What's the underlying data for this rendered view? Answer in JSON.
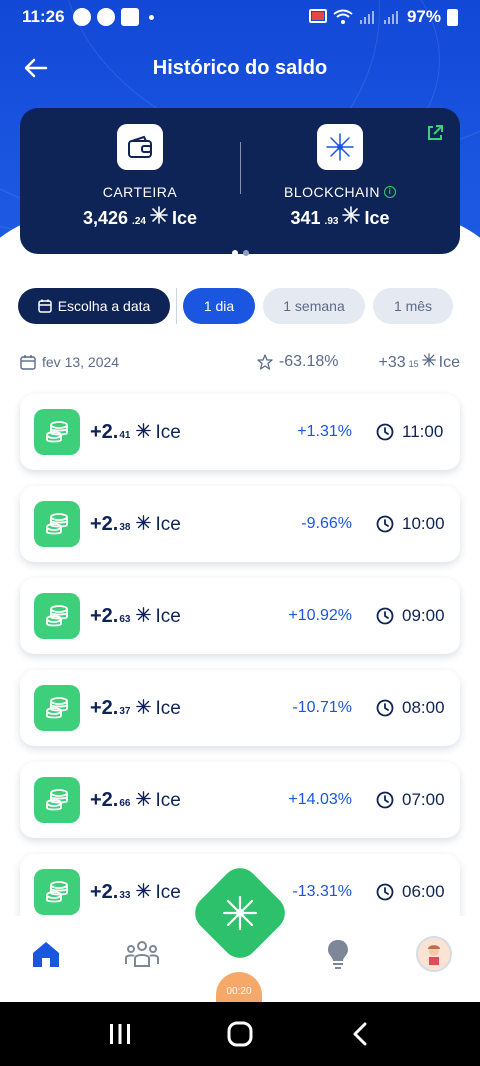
{
  "status_bar": {
    "time": "11:26",
    "battery": "97%"
  },
  "header": {
    "title": "Histórico do saldo"
  },
  "wallet": {
    "carteira": {
      "label": "CARTEIRA",
      "whole": "3,426",
      "fraction": ".24",
      "unit": "Ice"
    },
    "blockchain": {
      "label": "BLOCKCHAIN",
      "whole": "341",
      "fraction": ".93",
      "unit": "Ice"
    }
  },
  "filters": {
    "date_button": "Escolha a data",
    "chips": [
      "1 dia",
      "1 semana",
      "1 mês"
    ],
    "active_chip": "1 dia"
  },
  "summary": {
    "date": "fev 13, 2024",
    "change": "-63.18%",
    "total_whole": "+33",
    "total_fraction": "15",
    "unit": "Ice"
  },
  "history": [
    {
      "whole": "+2.",
      "fraction": "41",
      "unit": "Ice",
      "pct": "+1.31%",
      "time": "11:00"
    },
    {
      "whole": "+2.",
      "fraction": "38",
      "unit": "Ice",
      "pct": "-9.66%",
      "time": "10:00"
    },
    {
      "whole": "+2.",
      "fraction": "63",
      "unit": "Ice",
      "pct": "+10.92%",
      "time": "09:00"
    },
    {
      "whole": "+2.",
      "fraction": "37",
      "unit": "Ice",
      "pct": "-10.71%",
      "time": "08:00"
    },
    {
      "whole": "+2.",
      "fraction": "66",
      "unit": "Ice",
      "pct": "+14.03%",
      "time": "07:00"
    },
    {
      "whole": "+2.",
      "fraction": "33",
      "unit": "Ice",
      "pct": "-13.31%",
      "time": "06:00"
    }
  ],
  "bottom_nav": {
    "timer": "00:20",
    "icons": [
      "home-icon",
      "team-icon",
      "ice-logo-icon",
      "bulb-icon",
      "avatar-icon"
    ]
  },
  "colors": {
    "brand_blue": "#1a56e0",
    "navy": "#0f2456",
    "green": "#3ecf7a"
  }
}
